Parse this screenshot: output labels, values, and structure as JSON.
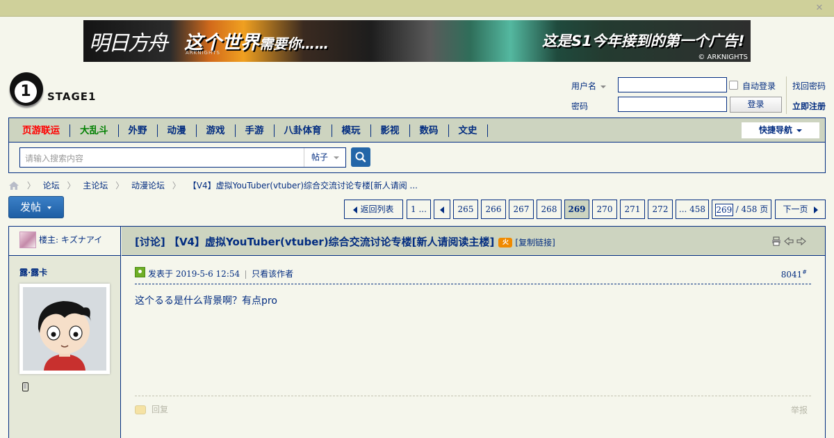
{
  "banner": {
    "game_name": "明日方舟",
    "game_en": "ARKNIGHTS",
    "slogan_main": "这个世界",
    "slogan_sub": "需要你……",
    "right_text": "这是S1今年接到的第一个广告!",
    "copyright": "© ARKNIGHTS"
  },
  "site": {
    "logo_glyph": "1",
    "logo_text": "STAGE1"
  },
  "login": {
    "username_label": "用户名",
    "password_label": "密码",
    "auto_login_label": "自动登录",
    "login_button": "登录",
    "find_password": "找回密码",
    "register": "立即注册"
  },
  "nav": {
    "items": [
      {
        "label": "页游联运",
        "color": "#ff0000"
      },
      {
        "label": "大乱斗",
        "color": "#008000"
      },
      {
        "label": "外野"
      },
      {
        "label": "动漫"
      },
      {
        "label": "游戏"
      },
      {
        "label": "手游"
      },
      {
        "label": "八卦体育"
      },
      {
        "label": "模玩"
      },
      {
        "label": "影视"
      },
      {
        "label": "数码"
      },
      {
        "label": "文史"
      }
    ],
    "quick_nav": "快捷导航"
  },
  "search": {
    "placeholder": "请输入搜索内容",
    "type": "帖子"
  },
  "breadcrumb": {
    "items": [
      "论坛",
      "主论坛",
      "动漫论坛",
      "【V4】虚拟YouTuber(vtuber)综合交流讨论专楼[新人请阅 ..."
    ]
  },
  "post_button": "发帖",
  "pager": {
    "back": "返回列表",
    "first": "1 ...",
    "pages": [
      "265",
      "266",
      "267",
      "268",
      "269",
      "270",
      "271",
      "272"
    ],
    "current": "269",
    "last": "... 458",
    "input_value": "269",
    "total": "/ 458 页",
    "next": "下一页"
  },
  "thread": {
    "owner_label": "楼主: キズナアイ",
    "category": "[讨论]",
    "title": "【V4】虚拟YouTuber(vtuber)综合交流讨论专楼[新人请阅读主楼]",
    "hot_icon": "火",
    "copy_link": "[复制链接]"
  },
  "post": {
    "author": "露·露卡",
    "posted_at": "发表于 2019-5-6 12:54",
    "only_author": "只看该作者",
    "floor": "8041",
    "floor_mark": "#",
    "content": "这个るる是什么背景啊？有点pro",
    "reply": "回复",
    "report": "举报"
  },
  "icons": {
    "close": "close-icon",
    "home": "home-icon",
    "search": "search-icon",
    "print": "print-icon",
    "prev": "prev-thread-icon",
    "next": "next-thread-icon",
    "phone": "mobile-icon",
    "online": "online-status-icon"
  },
  "colors": {
    "accent": "#022c80",
    "header_bg": "#cdd4c0",
    "page_bg": "#f5f6ec",
    "button_blue": "#2366a8"
  }
}
